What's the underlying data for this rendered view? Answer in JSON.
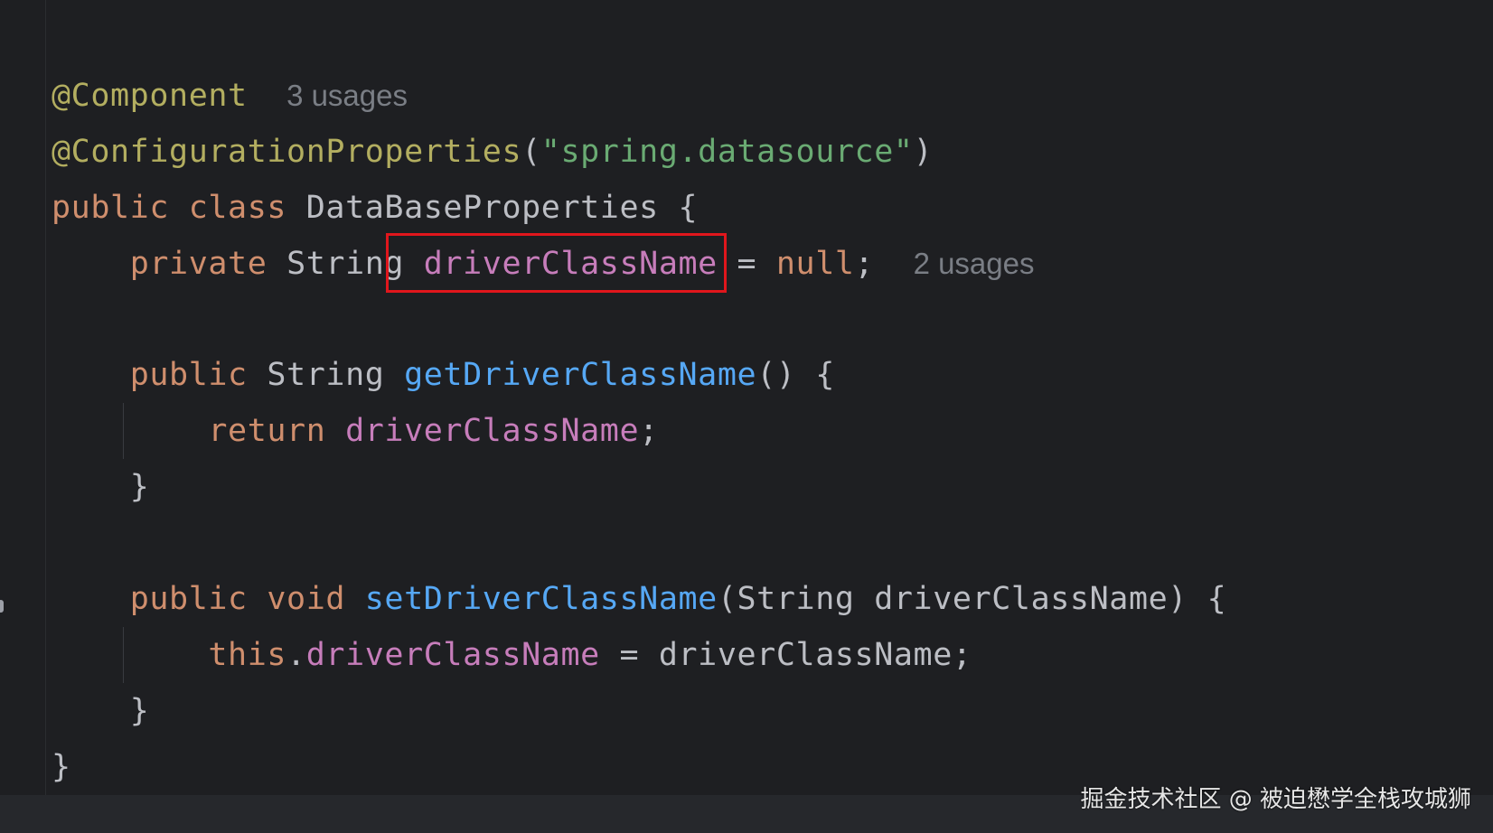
{
  "editor": {
    "lines": {
      "annot_component": "@Component",
      "hint_component": "3 usages",
      "annot_config": "@ConfigurationProperties",
      "config_open": "(",
      "config_arg": "\"spring.datasource\"",
      "config_close": ")",
      "class_public": "public",
      "class_kw": "class",
      "class_name": "DataBaseProperties {",
      "field_modifier": "private",
      "field_type": "String",
      "field_name": "driverClassName",
      "field_assign": "=",
      "field_value": "null",
      "field_semicolon": ";",
      "hint_field": "2 usages",
      "getter_public": "public",
      "getter_type": "String",
      "getter_name": "getDriverClassName",
      "getter_rest": "() {",
      "return_kw": "return",
      "return_field": "driverClassName",
      "return_semicolon": ";",
      "close_getter": "}",
      "setter_public": "public",
      "setter_void": "void",
      "setter_name": "setDriverClassName",
      "setter_params": "(String driverClassName) {",
      "this_kw": "this",
      "this_dot": ".",
      "this_field": "driverClassName",
      "this_rest": " = driverClassName;",
      "close_setter": "}",
      "close_class": "}"
    }
  },
  "watermark": "掘金技术社区 @ 被迫懋学全栈攻城狮",
  "colors": {
    "background": "#1e1f22",
    "keyword": "#cf8e6d",
    "annotation": "#b3ae60",
    "string": "#6aab73",
    "field": "#c77dbb",
    "method": "#56a8f5",
    "text": "#bcbec4",
    "hint": "#7a7e85",
    "highlight_border": "#e0161c"
  }
}
